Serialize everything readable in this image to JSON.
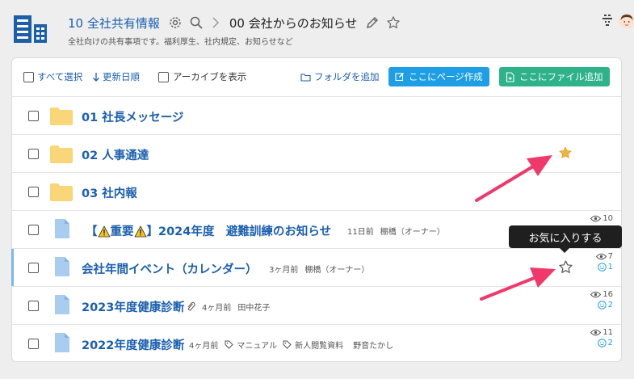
{
  "header": {
    "space_name": "10 全社共有情報",
    "page_title": "00 会社からのお知らせ",
    "subtitle": "全社向けの共有事項です。福利厚生、社内規定、お知らせなど"
  },
  "toolbar": {
    "select_all": "すべて選択",
    "sort_label": "更新日順",
    "show_archive": "アーカイブを表示",
    "add_folder": "フォルダを追加",
    "create_page": "ここにページ作成",
    "add_file": "ここにファイル追加"
  },
  "rows": [
    {
      "type": "folder",
      "title": "01 社長メッセージ"
    },
    {
      "type": "folder",
      "title": "02 人事通達"
    },
    {
      "type": "folder",
      "title": "03 社内報"
    },
    {
      "type": "page",
      "title_prefix": "【",
      "title_important": "重要",
      "title_suffix": "】2024年度　避難訓練のお知らせ",
      "time": "11日前",
      "author": "棚橋（オーナー）",
      "views": "10"
    },
    {
      "type": "page",
      "title": "会社年間イベント（カレンダー）",
      "time": "3ヶ月前",
      "author": "棚橋（オーナー）",
      "views": "7",
      "reactions": "1"
    },
    {
      "type": "page",
      "title": "2023年度健康診断",
      "time": "4ヶ月前",
      "author": "田中花子",
      "views": "16",
      "reactions": "2"
    },
    {
      "type": "page",
      "title": "2022年度健康診断",
      "time": "4ヶ月前",
      "tag1": "マニュアル",
      "tag2": "新人閲覧資料",
      "author": "野音たかし",
      "views": "11",
      "reactions": "2"
    }
  ],
  "tooltip": {
    "text": "お気に入りする"
  },
  "colors": {
    "accent": "#1a5fb0",
    "button_blue": "#1d9ee5",
    "button_green": "#2eb28a",
    "star_filled": "#f0b43c",
    "arrow": "#f0396a"
  }
}
